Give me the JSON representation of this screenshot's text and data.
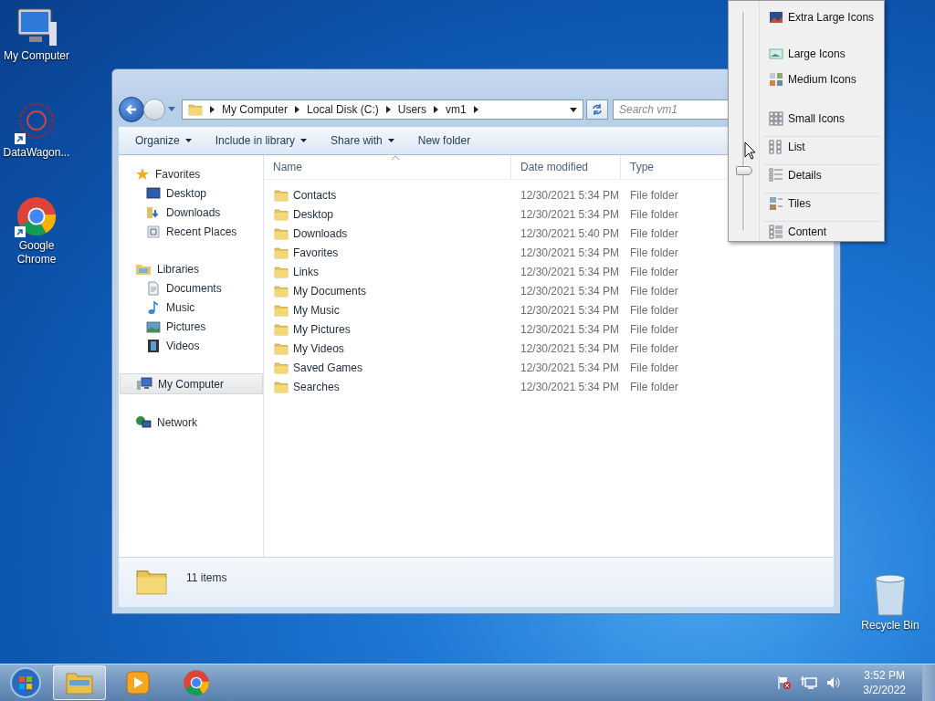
{
  "desktop_icons": [
    {
      "label": "My Computer",
      "kind": "computer",
      "shortcut": false
    },
    {
      "label": "DataWagon...",
      "kind": "app",
      "shortcut": true
    },
    {
      "label": "Google Chrome",
      "kind": "chrome",
      "shortcut": true
    },
    {
      "label": "Recycle Bin",
      "kind": "recycle",
      "shortcut": false
    }
  ],
  "window": {
    "breadcrumb": [
      "My Computer",
      "Local Disk (C:)",
      "Users",
      "vm1"
    ],
    "search": {
      "placeholder": "Search vm1"
    },
    "toolbar": [
      {
        "label": "Organize",
        "has_menu": true
      },
      {
        "label": "Include in library",
        "has_menu": true
      },
      {
        "label": "Share with",
        "has_menu": true
      },
      {
        "label": "New folder",
        "has_menu": false
      }
    ],
    "nav": [
      {
        "label": "Favorites",
        "kind": "star",
        "selected": false,
        "children": [
          {
            "label": "Desktop",
            "kind": "desktop",
            "selected": false
          },
          {
            "label": "Downloads",
            "kind": "downloads",
            "selected": false
          },
          {
            "label": "Recent Places",
            "kind": "recent",
            "selected": false
          }
        ]
      },
      {
        "label": "Libraries",
        "kind": "library",
        "selected": false,
        "children": [
          {
            "label": "Documents",
            "kind": "documents",
            "selected": false
          },
          {
            "label": "Music",
            "kind": "music",
            "selected": false
          },
          {
            "label": "Pictures",
            "kind": "pictures",
            "selected": false
          },
          {
            "label": "Videos",
            "kind": "videos",
            "selected": false
          }
        ]
      },
      {
        "label": "My Computer",
        "kind": "computer",
        "selected": true
      },
      {
        "label": "Network",
        "kind": "network",
        "selected": false
      }
    ],
    "columns": [
      {
        "label": "Name",
        "sorted": true
      },
      {
        "label": "Date modified",
        "sorted": false
      },
      {
        "label": "Type",
        "sorted": false
      }
    ],
    "rows": [
      {
        "name": "Contacts",
        "date": "12/30/2021 5:34 PM",
        "type": "File folder"
      },
      {
        "name": "Desktop",
        "date": "12/30/2021 5:34 PM",
        "type": "File folder"
      },
      {
        "name": "Downloads",
        "date": "12/30/2021 5:40 PM",
        "type": "File folder"
      },
      {
        "name": "Favorites",
        "date": "12/30/2021 5:34 PM",
        "type": "File folder"
      },
      {
        "name": "Links",
        "date": "12/30/2021 5:34 PM",
        "type": "File folder"
      },
      {
        "name": "My Documents",
        "date": "12/30/2021 5:34 PM",
        "type": "File folder"
      },
      {
        "name": "My Music",
        "date": "12/30/2021 5:34 PM",
        "type": "File folder"
      },
      {
        "name": "My Pictures",
        "date": "12/30/2021 5:34 PM",
        "type": "File folder"
      },
      {
        "name": "My Videos",
        "date": "12/30/2021 5:34 PM",
        "type": "File folder"
      },
      {
        "name": "Saved Games",
        "date": "12/30/2021 5:34 PM",
        "type": "File folder"
      },
      {
        "name": "Searches",
        "date": "12/30/2021 5:34 PM",
        "type": "File folder"
      }
    ],
    "status": "11 items"
  },
  "view_menu": {
    "level": 0.26,
    "items": [
      {
        "label": "Extra Large Icons",
        "kind": "xl"
      },
      {
        "label": "Large Icons",
        "kind": "large"
      },
      {
        "label": "Medium Icons",
        "kind": "medium"
      },
      {
        "label": "Small Icons",
        "kind": "small"
      },
      {
        "label": "List",
        "kind": "list"
      },
      {
        "label": "Details",
        "kind": "details"
      },
      {
        "label": "Tiles",
        "kind": "tiles"
      },
      {
        "label": "Content",
        "kind": "content"
      }
    ]
  },
  "taskbar": {
    "apps": [
      {
        "kind": "explorer",
        "active": true
      },
      {
        "kind": "media",
        "active": false
      },
      {
        "kind": "chrome",
        "active": false
      }
    ],
    "time": "3:52 PM",
    "date": "3/2/2022"
  }
}
